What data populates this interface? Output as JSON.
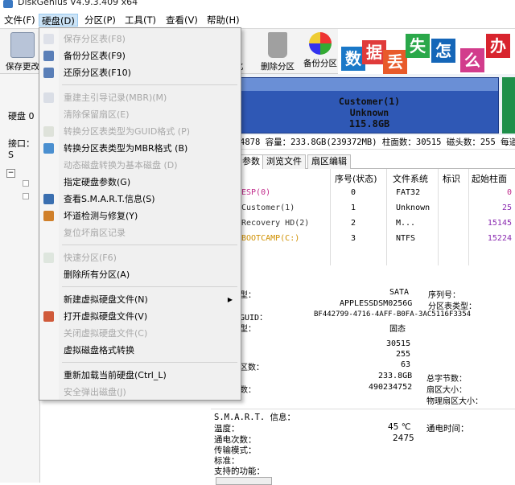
{
  "window": {
    "title": "DiskGenius V4.9.3.409 x64"
  },
  "menubar": [
    {
      "label": "文件(F)",
      "active": false
    },
    {
      "label": "硬盘(D)",
      "active": true
    },
    {
      "label": "分区(P)",
      "active": false
    },
    {
      "label": "工具(T)",
      "active": false
    },
    {
      "label": "查看(V)",
      "active": false
    },
    {
      "label": "帮助(H)",
      "active": false
    }
  ],
  "toolbar": {
    "save_label": "保存更改",
    "format_label": "化",
    "delete_label": "删除分区",
    "backup_label": "备份分区"
  },
  "banner": {
    "chars": [
      "数",
      "据",
      "丢",
      "失",
      "怎",
      "么",
      "办"
    ],
    "colors": [
      "#1a78c8",
      "#e03b3b",
      "#e85a2a",
      "#2aa84a",
      "#1566b8",
      "#d23c8c",
      "#d8242e"
    ]
  },
  "left": {
    "disk_label": "硬盘 0",
    "interface_label": "接口：S"
  },
  "disk_partition": {
    "name": "Customer(1)",
    "fs": "Unknown",
    "size": "115.8GB"
  },
  "infoline": {
    "text": "4878  容量：233.8GB(239372MB)  柱面数：30515  磁头数：255  每道"
  },
  "tabs": [
    "参数",
    "浏览文件",
    "扇区编辑"
  ],
  "table": {
    "headers": [
      "序号(状态)",
      "文件系统",
      "标识",
      "起始柱面"
    ],
    "rows": [
      {
        "name": "ESP(0)",
        "index": "0",
        "fs": "FAT32",
        "id": "",
        "start": "0",
        "color": "#c02a8a"
      },
      {
        "name": "Customer(1)",
        "index": "1",
        "fs": "Unknown",
        "id": "",
        "start": "25",
        "color": "#333"
      },
      {
        "name": "Recovery HD(2)",
        "index": "2",
        "fs": "M...",
        "id": "",
        "start": "15145",
        "color": "#333"
      },
      {
        "name": "BOOTCAMP(C:)",
        "index": "3",
        "fs": "NTFS",
        "id": "",
        "start": "15224",
        "color": "#d09000"
      }
    ]
  },
  "details": {
    "type_label": "型：",
    "type_value": "SATA",
    "serial_label": "序列号：",
    "model_value": "APPLESSDSM0256G",
    "part_type_label": "分区表类型：",
    "guid_label": "GUID：",
    "guid_value": "BF442799-4716-4AFF-B0FA-3AC5116F3354",
    "kind_label": "型：",
    "kind_value": "固态",
    "cyl_value": "30515",
    "heads_value": "255",
    "sect_label": "区数：",
    "sect_value": "63",
    "cap_value": "233.8GB",
    "total_bytes_label": "总字节数：",
    "total_sect_label": "数：",
    "total_sect_value": "490234752",
    "sector_size_label": "扇区大小：",
    "phys_sector_label": "物理扇区大小："
  },
  "smart": {
    "title": "S.M.A.R.T. 信息：",
    "temp_label": "温度：",
    "temp_value": "45 ℃",
    "power_time_label": "通电时间：",
    "power_count_label": "通电次数：",
    "power_count_value": "2475",
    "transfer_label": "传输模式：",
    "standard_label": "标准：",
    "features_label": "支持的功能："
  },
  "dropdown": [
    {
      "label": "保存分区表(F8)",
      "enabled": false,
      "icon": "save-icon",
      "sep_after": false
    },
    {
      "label": "备份分区表(F9)",
      "enabled": true,
      "icon": "backup-table-icon",
      "sep_after": false
    },
    {
      "label": "还原分区表(F10)",
      "enabled": true,
      "icon": "restore-table-icon",
      "sep_after": true
    },
    {
      "label": "重建主引导记录(MBR)(M)",
      "enabled": false,
      "icon": "rebuild-mbr-icon",
      "sep_after": false
    },
    {
      "label": "清除保留扇区(E)",
      "enabled": false,
      "icon": "",
      "sep_after": false
    },
    {
      "label": "转换分区表类型为GUID格式 (P)",
      "enabled": false,
      "icon": "convert-guid-icon",
      "sep_after": false
    },
    {
      "label": "转换分区表类型为MBR格式 (B)",
      "enabled": true,
      "icon": "convert-mbr-icon",
      "sep_after": false
    },
    {
      "label": "动态磁盘转换为基本磁盘 (D)",
      "enabled": false,
      "icon": "",
      "sep_after": false
    },
    {
      "label": "指定硬盘参数(G)",
      "enabled": true,
      "icon": "",
      "sep_after": false
    },
    {
      "label": "查看S.M.A.R.T.信息(S)",
      "enabled": true,
      "icon": "smart-info-icon",
      "sep_after": false
    },
    {
      "label": "坏道检测与修复(Y)",
      "enabled": true,
      "icon": "repair-tools-icon",
      "sep_after": false
    },
    {
      "label": "复位坏扇区记录",
      "enabled": false,
      "icon": "",
      "sep_after": true
    },
    {
      "label": "快速分区(F6)",
      "enabled": false,
      "icon": "quick-partition-icon",
      "sep_after": false
    },
    {
      "label": "删除所有分区(A)",
      "enabled": true,
      "icon": "",
      "sep_after": true
    },
    {
      "label": "新建虚拟硬盘文件(N)",
      "enabled": true,
      "icon": "",
      "sep_after": false,
      "submenu": true
    },
    {
      "label": "打开虚拟硬盘文件(V)",
      "enabled": true,
      "icon": "open-vdisk-icon",
      "sep_after": false
    },
    {
      "label": "关闭虚拟硬盘文件(C)",
      "enabled": false,
      "icon": "",
      "sep_after": false
    },
    {
      "label": "虚拟磁盘格式转换",
      "enabled": true,
      "icon": "",
      "sep_after": true
    },
    {
      "label": "重新加载当前硬盘(Ctrl_L)",
      "enabled": true,
      "icon": "",
      "sep_after": false
    },
    {
      "label": "安全弹出磁盘(J)",
      "enabled": false,
      "icon": "",
      "sep_after": false
    }
  ],
  "colors": {
    "accent": "#cce4f7",
    "partition_blue": "#2f58b5",
    "disabled": "#a8a8a8"
  }
}
